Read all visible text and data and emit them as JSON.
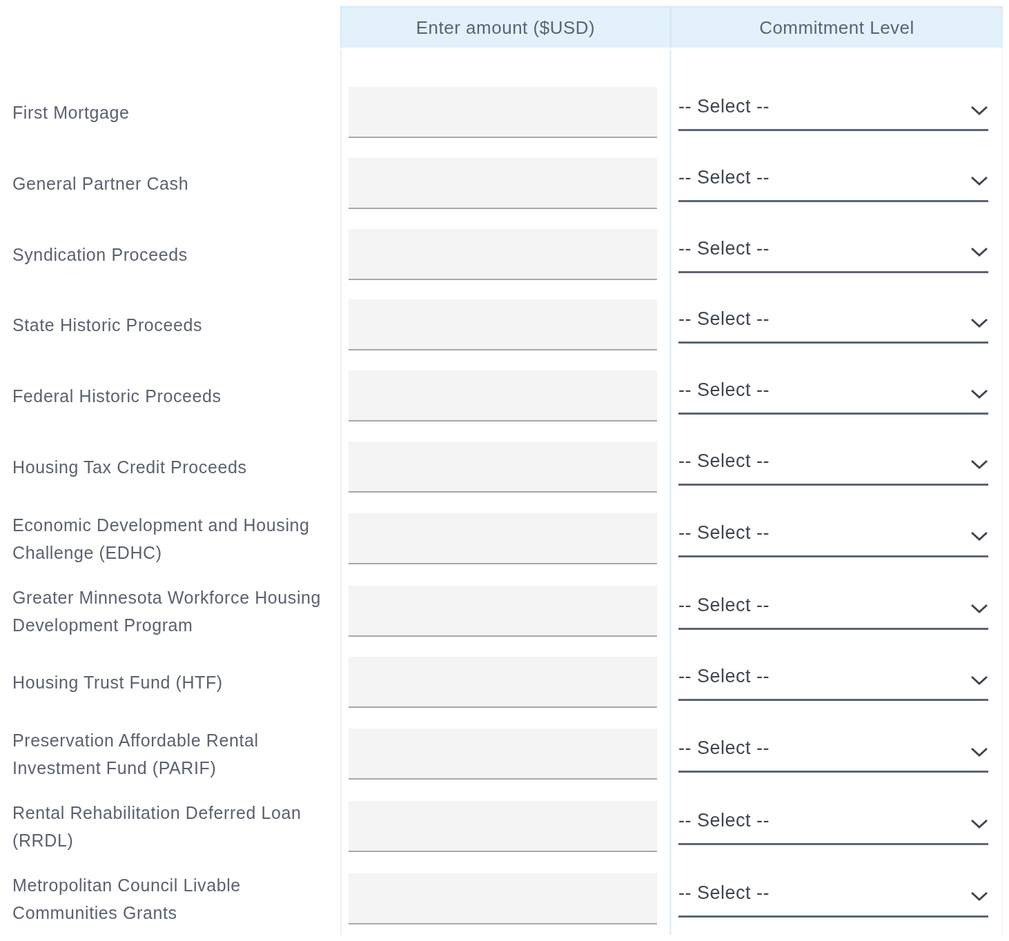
{
  "columns": [
    {
      "label": "Enter amount ($USD)"
    },
    {
      "label": "Commitment Level"
    }
  ],
  "rows": [
    {
      "label": "First Mortgage",
      "select": "-- Select --"
    },
    {
      "label": "General Partner Cash",
      "select": "-- Select --"
    },
    {
      "label": "Syndication Proceeds",
      "select": "-- Select --"
    },
    {
      "label": "State Historic Proceeds",
      "select": "-- Select --"
    },
    {
      "label": "Federal Historic Proceeds",
      "select": "-- Select --"
    },
    {
      "label": "Housing Tax Credit Proceeds",
      "select": "-- Select --"
    },
    {
      "label": "Economic Development and Housing Challenge (EDHC)",
      "select": "-- Select --"
    },
    {
      "label": "Greater Minnesota Workforce Housing Development Program",
      "select": "-- Select --"
    },
    {
      "label": "Housing Trust Fund (HTF)",
      "select": "-- Select --"
    },
    {
      "label": "Preservation Affordable Rental Investment Fund (PARIF)",
      "select": "-- Select --"
    },
    {
      "label": "Rental Rehabilitation Deferred Loan (RRDL)",
      "select": "-- Select --"
    },
    {
      "label": "Metropolitan Council Livable Communities Grants",
      "select": "-- Select --"
    }
  ]
}
